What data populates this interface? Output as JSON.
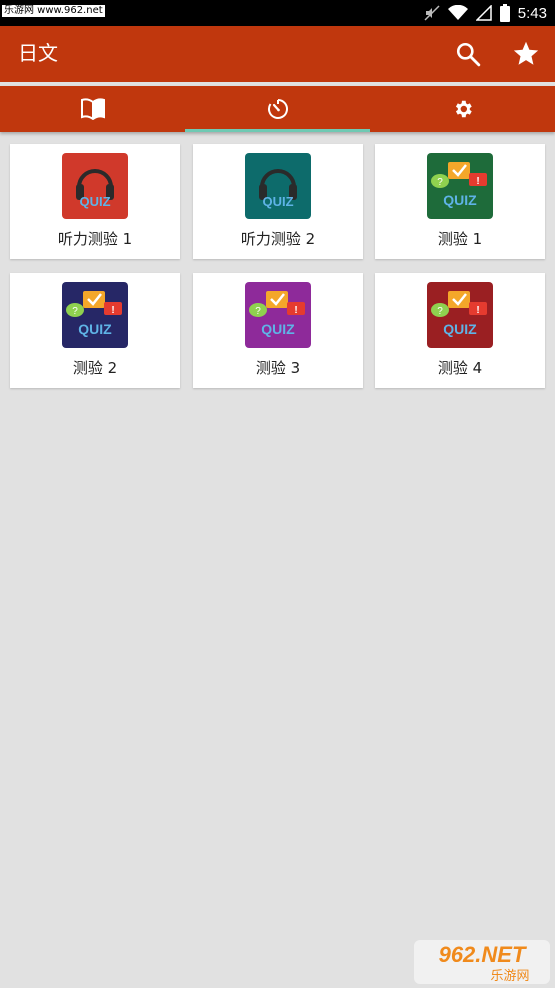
{
  "status_bar": {
    "site_tag": "乐游网 www.962.net",
    "time": "5:43"
  },
  "app_bar": {
    "title": "日文",
    "search_icon": "search-icon",
    "star_icon": "star-icon"
  },
  "tabs": [
    {
      "icon": "book-icon"
    },
    {
      "icon": "timer-icon",
      "selected": true
    },
    {
      "icon": "gear-icon"
    }
  ],
  "cards": [
    {
      "label": "听力测验 1",
      "icon": "headphones-quiz-icon",
      "color": "#d0392b"
    },
    {
      "label": "听力测验 2",
      "icon": "headphones-quiz-icon",
      "color": "#0d6b6b"
    },
    {
      "label": "测验 1",
      "icon": "chat-bubbles-quiz-icon",
      "color": "#1e6b3a"
    },
    {
      "label": "测验 2",
      "icon": "chat-bubbles-quiz-icon",
      "color": "#262766"
    },
    {
      "label": "测验 3",
      "icon": "chat-bubbles-quiz-icon",
      "color": "#8e2a9a"
    },
    {
      "label": "测验 4",
      "icon": "chat-bubbles-quiz-icon",
      "color": "#9a1f22"
    }
  ],
  "quiz_badge_text": "QUIZ",
  "watermark": {
    "top": "962.NET",
    "bottom": "乐游网"
  },
  "colors": {
    "primary": "#c0370d",
    "accent": "#6fc9b3",
    "background": "#e1e1e1"
  }
}
